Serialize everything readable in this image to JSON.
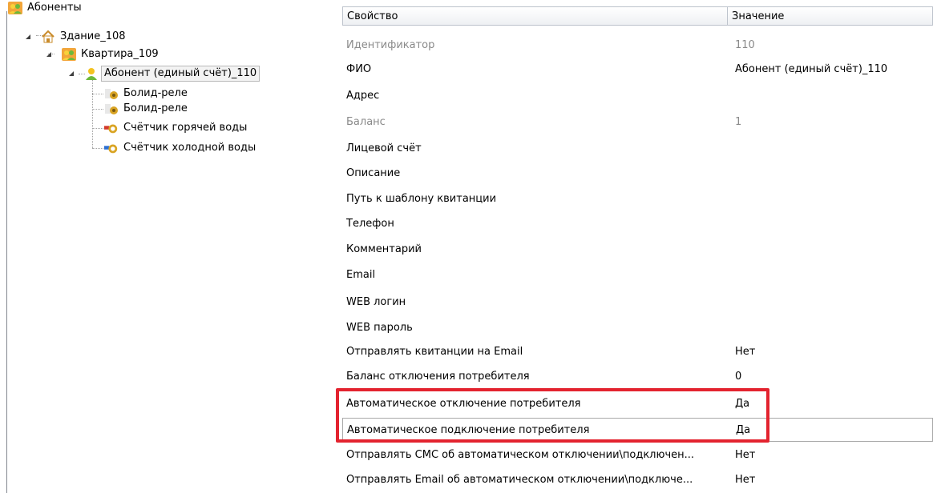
{
  "tree": {
    "root": "Абоненты",
    "building": "Здание_108",
    "apartment": "Квартира_109",
    "subscriber": "Абонент (единый счёт)_110",
    "devices": [
      "Болид-реле",
      "Болид-реле",
      "Счётчик горячей воды",
      "Счётчик холодной воды"
    ]
  },
  "grid": {
    "col_property": "Свойство",
    "col_value": "Значение",
    "rows": [
      {
        "property": "Идентификатор",
        "value": "110"
      },
      {
        "property": "ФИО",
        "value": "Абонент (единый счёт)_110"
      },
      {
        "property": "Адрес",
        "value": ""
      },
      {
        "property": "Баланс",
        "value": "1"
      },
      {
        "property": "Лицевой счёт",
        "value": ""
      },
      {
        "property": "Описание",
        "value": ""
      },
      {
        "property": "Путь к шаблону квитанции",
        "value": ""
      },
      {
        "property": "Телефон",
        "value": ""
      },
      {
        "property": "Комментарий",
        "value": ""
      },
      {
        "property": "Email",
        "value": ""
      },
      {
        "property": "WEB логин",
        "value": ""
      },
      {
        "property": "WEB пароль",
        "value": ""
      },
      {
        "property": "Отправлять квитанции на Email",
        "value": "Нет"
      },
      {
        "property": "Баланс отключения потребителя",
        "value": "0"
      },
      {
        "property": "Автоматическое отключение потребителя",
        "value": "Да"
      },
      {
        "property": "Автоматическое подключение потребителя",
        "value": "Да"
      },
      {
        "property": "Отправлять СМС об автоматическом отключении\\подключен...",
        "value": "Нет"
      },
      {
        "property": "Отправлять Email об автоматическом отключении\\подключе...",
        "value": "Нет"
      }
    ]
  },
  "icons": {
    "root": "users-group-icon",
    "building": "house-icon",
    "apartment": "users-group-icon",
    "subscriber": "user-icon",
    "relay": "relay-device-icon",
    "hot_meter": "hot-water-meter-icon",
    "cold_meter": "cold-water-meter-icon"
  },
  "colors": {
    "highlight": "#e3232f",
    "readonly_text": "#8a8a8a",
    "grid_border": "#bdc3cc"
  }
}
